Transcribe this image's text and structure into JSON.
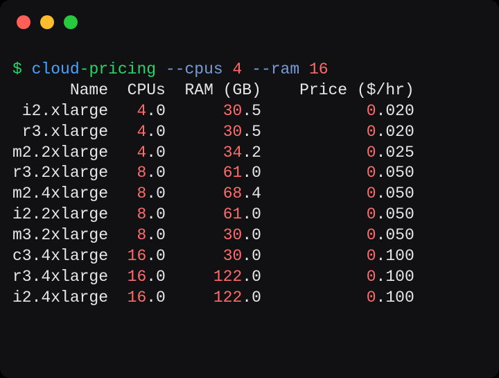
{
  "prompt_symbol": "$",
  "command": {
    "name": "cloud-pricing",
    "args": [
      {
        "flag": "--cpus",
        "value": "4"
      },
      {
        "flag": "--ram",
        "value": "16"
      }
    ]
  },
  "columns": {
    "name": "Name",
    "cpus": "CPUs",
    "ram": "RAM (GB)",
    "price": "Price ($/hr)"
  },
  "rows": [
    {
      "name": "i2.xlarge",
      "cpus": "4.0",
      "ram": "30.5",
      "price": "0.020"
    },
    {
      "name": "r3.xlarge",
      "cpus": "4.0",
      "ram": "30.5",
      "price": "0.020"
    },
    {
      "name": "m2.2xlarge",
      "cpus": "4.0",
      "ram": "34.2",
      "price": "0.025"
    },
    {
      "name": "r3.2xlarge",
      "cpus": "8.0",
      "ram": "61.0",
      "price": "0.050"
    },
    {
      "name": "m2.4xlarge",
      "cpus": "8.0",
      "ram": "68.4",
      "price": "0.050"
    },
    {
      "name": "i2.2xlarge",
      "cpus": "8.0",
      "ram": "61.0",
      "price": "0.050"
    },
    {
      "name": "m3.2xlarge",
      "cpus": "8.0",
      "ram": "30.0",
      "price": "0.050"
    },
    {
      "name": "c3.4xlarge",
      "cpus": "16.0",
      "ram": "30.0",
      "price": "0.100"
    },
    {
      "name": "r3.4xlarge",
      "cpus": "16.0",
      "ram": "122.0",
      "price": "0.100"
    },
    {
      "name": "i2.4xlarge",
      "cpus": "16.0",
      "ram": "122.0",
      "price": "0.100"
    }
  ],
  "chart_data": {
    "type": "table",
    "title": "cloud-pricing --cpus 4 --ram 16",
    "columns": [
      "Name",
      "CPUs",
      "RAM (GB)",
      "Price ($/hr)"
    ],
    "rows": [
      [
        "i2.xlarge",
        4.0,
        30.5,
        0.02
      ],
      [
        "r3.xlarge",
        4.0,
        30.5,
        0.02
      ],
      [
        "m2.2xlarge",
        4.0,
        34.2,
        0.025
      ],
      [
        "r3.2xlarge",
        8.0,
        61.0,
        0.05
      ],
      [
        "m2.4xlarge",
        8.0,
        68.4,
        0.05
      ],
      [
        "i2.2xlarge",
        8.0,
        61.0,
        0.05
      ],
      [
        "m3.2xlarge",
        8.0,
        30.0,
        0.05
      ],
      [
        "c3.4xlarge",
        16.0,
        30.0,
        0.1
      ],
      [
        "r3.4xlarge",
        16.0,
        122.0,
        0.1
      ],
      [
        "i2.4xlarge",
        16.0,
        122.0,
        0.1
      ]
    ]
  }
}
